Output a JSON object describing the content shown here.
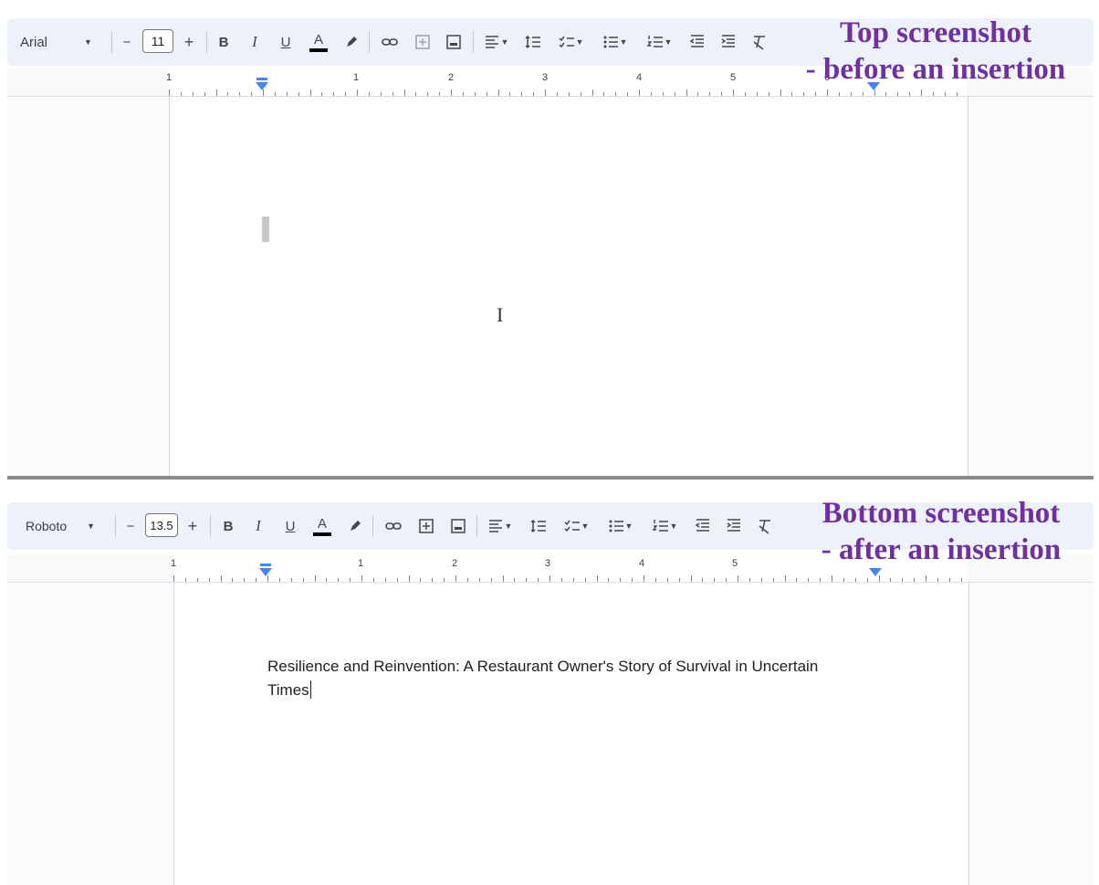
{
  "top": {
    "font_name": "Arial",
    "font_size": "11",
    "caption_line1": "Top screenshot",
    "caption_line2": "- before an insertion",
    "ruler_numbers": [
      "1",
      "1",
      "2",
      "3",
      "4",
      "5",
      "6"
    ]
  },
  "bottom": {
    "font_name": "Roboto",
    "font_size": "13.5",
    "caption_line1": "Bottom screenshot",
    "caption_line2": "- after an insertion",
    "ruler_numbers": [
      "1",
      "1",
      "2",
      "3",
      "4",
      "5"
    ],
    "document_text": "Resilience and Reinvention: A Restaurant Owner's Story of Survival in Uncertain Times"
  },
  "toolbar": {
    "decrease_label": "−",
    "increase_label": "+",
    "bold_label": "B",
    "italic_label": "I",
    "underline_label": "U",
    "text_color_label": "A",
    "icons": [
      "pencil-icon",
      "link-icon",
      "add-comment-icon",
      "insert-image-icon",
      "align-left-icon",
      "line-spacing-icon",
      "checklist-icon",
      "bulleted-list-icon",
      "numbered-list-icon",
      "decrease-indent-icon",
      "increase-indent-icon",
      "clear-formatting-icon"
    ]
  },
  "colors": {
    "toolbar_bg": "#edf2fa",
    "caption": "#7030a0",
    "ruler_marker": "#4285f4"
  }
}
